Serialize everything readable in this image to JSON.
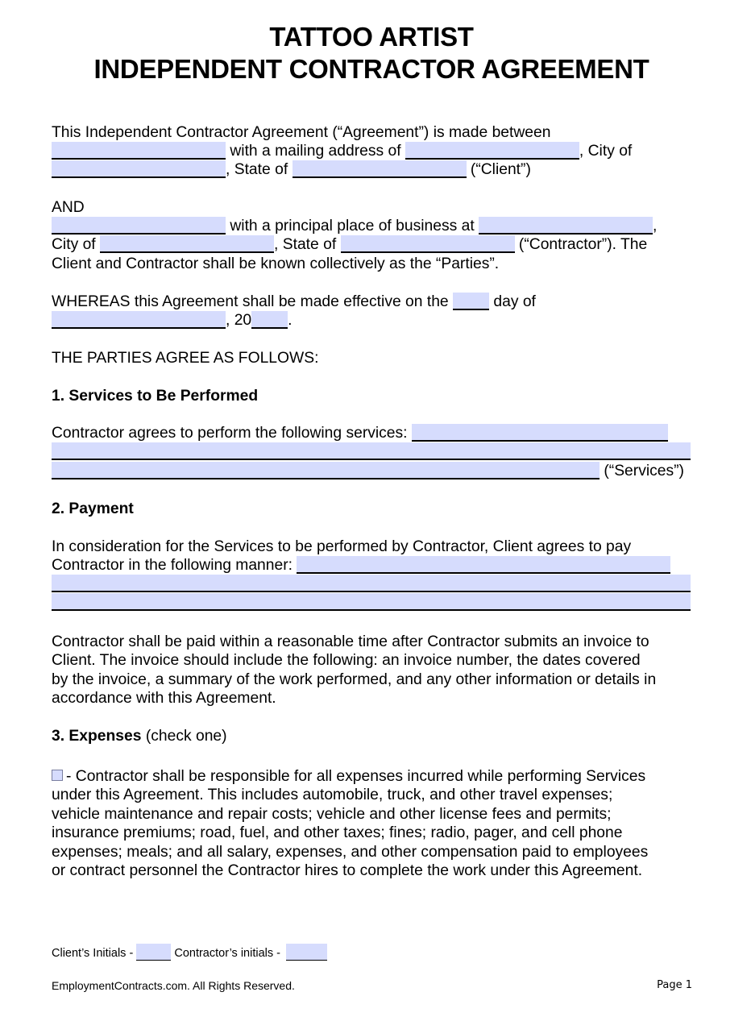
{
  "document": {
    "title_line1": "TATTOO ARTIST",
    "title_line2": "INDEPENDENT CONTRACTOR AGREEMENT"
  },
  "intro": {
    "line1": "This Independent Contractor Agreement (“Agreement”) is made between",
    "mailing": "with a mailing address of",
    "city_of": ", City of",
    "state_of": ", State of",
    "client": "(“Client”)",
    "fields": {
      "client_name": "",
      "client_address": "",
      "client_city": "",
      "client_state": ""
    }
  },
  "contractor": {
    "and": "AND",
    "principal": "with a principal place of business at",
    "comma": ",",
    "city_of": "City of",
    "state_of": ", State of",
    "contractor_label": "(“Contractor”). The",
    "parties_line": "Client and Contractor shall be known collectively as the “Parties”.",
    "fields": {
      "contractor_name": "",
      "contractor_address": "",
      "contractor_city": "",
      "contractor_state": ""
    }
  },
  "effective": {
    "whereas": "WHEREAS this Agreement shall be made effective on the",
    "day_of": "day of",
    "comma_20": ", 20",
    "period": ".",
    "fields": {
      "day": "",
      "month": "",
      "year": ""
    }
  },
  "agree": "THE PARTIES AGREE AS FOLLOWS:",
  "section1": {
    "heading": "1. Services to Be Performed",
    "text": "Contractor agrees to perform the following services:",
    "services_label": "(“Services”)",
    "fields": {
      "services": ""
    }
  },
  "section2": {
    "heading": "2. Payment",
    "line1": "In consideration for the Services to be performed by Contractor, Client agrees to pay",
    "line2": "Contractor in the following manner:",
    "para": [
      "Contractor shall be paid within a reasonable time after Contractor submits an invoice to",
      "Client. The invoice should include the following: an invoice number, the dates covered",
      "by the invoice, a summary of the work performed, and any other information or details in",
      "accordance with this Agreement."
    ],
    "fields": {
      "payment": ""
    }
  },
  "section3": {
    "heading": "3. Expenses",
    "heading_note": "(check one)",
    "option1": {
      "checked": false,
      "lines": [
        "- Contractor shall be responsible for all expenses incurred while performing Services",
        "under this Agreement. This includes automobile, truck, and other travel expenses;",
        "vehicle maintenance and repair costs; vehicle and other license fees and permits;",
        "insurance premiums; road, fuel, and other taxes; fines; radio, pager, and cell phone",
        "expenses; meals; and all salary, expenses, and other compensation paid to employees",
        "or contract personnel the Contractor hires to complete the work under this Agreement."
      ]
    }
  },
  "footer": {
    "client_initials": "Client’s Initials -",
    "contractor_initials": "Contractor’s initials -",
    "copyright": "EmploymentContracts.com. All Rights Reserved.",
    "page": "Page 1",
    "fields": {
      "client_initials": "",
      "contractor_initials": ""
    }
  },
  "colors": {
    "field_fill": "#d6dcfd"
  }
}
